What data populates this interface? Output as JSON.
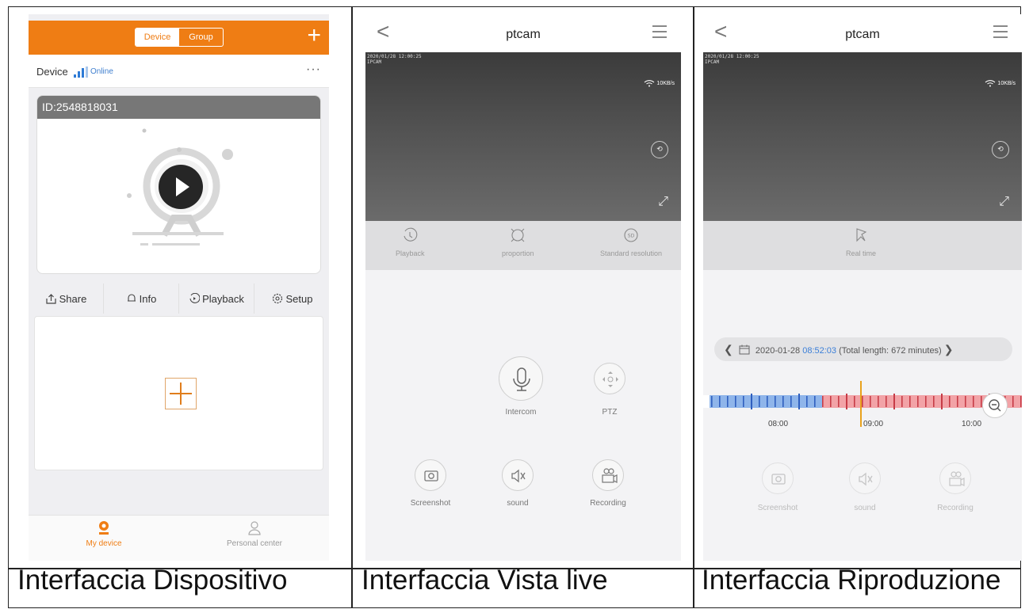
{
  "panel1": {
    "seg_device": "Device",
    "seg_group": "Group",
    "plus": "+",
    "device_label": "Device",
    "online": "Online",
    "more": "···",
    "card_id": "ID:2548818031",
    "actions": [
      "Share",
      "Info",
      "Playback",
      "Setup"
    ],
    "tabs": [
      "My device",
      "Personal center"
    ],
    "accent": "#ef7d14"
  },
  "panel2": {
    "title": "ptcam",
    "back": "<",
    "timestamp": "2020/01/28 12:00:25",
    "osd": "IPCAM",
    "speed": "10KB/s",
    "ctrl": [
      "Playback",
      "proportion",
      "Standard resolution"
    ],
    "intercom": "Intercom",
    "ptz": "PTZ",
    "screenshot": "Screenshot",
    "sound": "sound",
    "recording": "Recording"
  },
  "panel3": {
    "title": "ptcam",
    "back": "<",
    "timestamp": "2020/01/28 12:00:25",
    "osd": "IPCAM",
    "speed": "10KB/s",
    "realtime": "Real time",
    "date_prefix": "2020-01-28",
    "date_time": "08:52:03",
    "date_suffix": "(Total length: 672 minutes)",
    "ticks": [
      "08:00",
      "09:00",
      "10:00"
    ],
    "screenshot": "Screenshot",
    "sound": "sound",
    "recording": "Recording"
  },
  "captions": [
    "Interfaccia Dispositivo",
    "Interfaccia Vista live",
    "Interfaccia Riproduzione"
  ]
}
